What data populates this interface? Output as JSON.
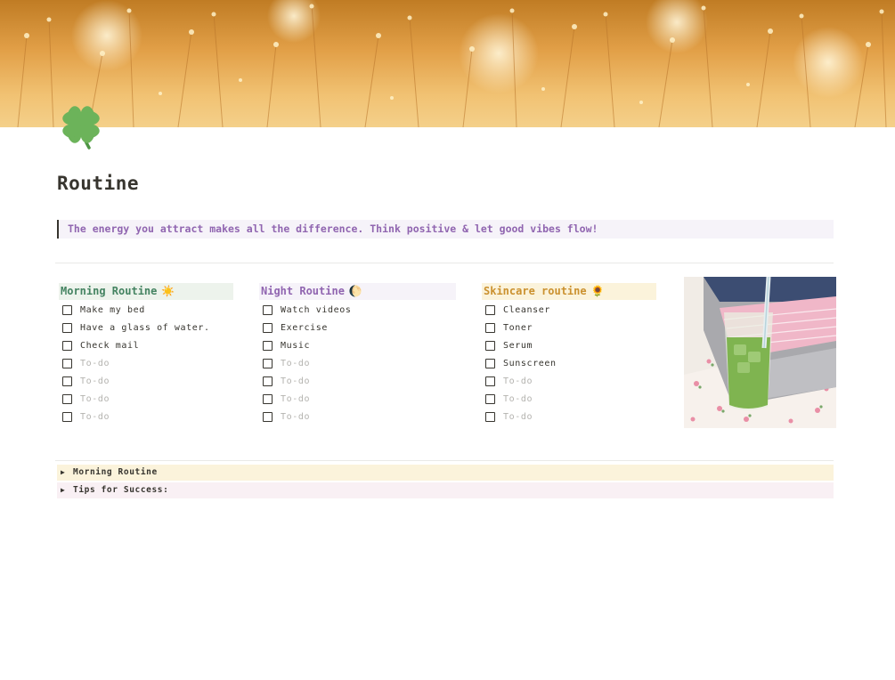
{
  "page": {
    "title": "Routine",
    "icon": "four-leaf-clover-icon",
    "cover": "golden-field-photo",
    "quote": "The energy you attract makes all the difference. Think positive & let good vibes flow!"
  },
  "columns": [
    {
      "title": "Morning Routine",
      "emoji": "☀️",
      "header_bg": "#edf3ec",
      "header_color": "#448361",
      "items": [
        {
          "label": "Make my bed",
          "placeholder": false
        },
        {
          "label": "Have a glass of water.",
          "placeholder": false
        },
        {
          "label": "Check mail",
          "placeholder": false
        },
        {
          "label": "To-do",
          "placeholder": true
        },
        {
          "label": "To-do",
          "placeholder": true
        },
        {
          "label": "To-do",
          "placeholder": true
        },
        {
          "label": "To-do",
          "placeholder": true
        }
      ]
    },
    {
      "title": "Night Routine",
      "emoji": "🌔",
      "header_bg": "#f6f3f9",
      "header_color": "#9065b0",
      "items": [
        {
          "label": "Watch videos",
          "placeholder": false
        },
        {
          "label": "Exercise",
          "placeholder": false
        },
        {
          "label": "Music",
          "placeholder": false
        },
        {
          "label": "To-do",
          "placeholder": true
        },
        {
          "label": "To-do",
          "placeholder": true
        },
        {
          "label": "To-do",
          "placeholder": true
        },
        {
          "label": "To-do",
          "placeholder": true
        }
      ]
    },
    {
      "title": "Skincare routine",
      "emoji": "🌻",
      "header_bg": "#fbf3db",
      "header_color": "#cb912f",
      "items": [
        {
          "label": "Cleanser",
          "placeholder": false
        },
        {
          "label": "Toner",
          "placeholder": false
        },
        {
          "label": "Serum",
          "placeholder": false
        },
        {
          "label": "Sunscreen",
          "placeholder": false
        },
        {
          "label": "To-do",
          "placeholder": true
        },
        {
          "label": "To-do",
          "placeholder": true
        },
        {
          "label": "To-do",
          "placeholder": true
        }
      ]
    }
  ],
  "image": {
    "subject": "iced-matcha-drink-photo"
  },
  "toggles": [
    {
      "label": "Morning Routine",
      "bg": "#fbf3db"
    },
    {
      "label": "Tips for Success:",
      "bg": "#f9f0f4"
    }
  ]
}
